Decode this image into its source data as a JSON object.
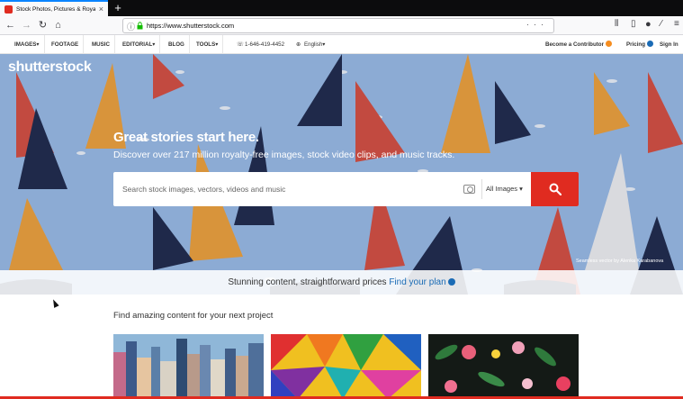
{
  "browser": {
    "tab_title": "Stock Photos, Pictures & Royalty",
    "new_tab_label": "+",
    "url": "https://www.shutterstock.com"
  },
  "sitenav": {
    "items": [
      "IMAGES▾",
      "FOOTAGE",
      "MUSIC",
      "EDITORIAL▾",
      "BLOG",
      "TOOLS▾"
    ],
    "phone": "1-646-419-4452",
    "language": "English▾",
    "contributor": "Become a Contributor",
    "pricing": "Pricing",
    "signin": "Sign In"
  },
  "hero": {
    "logo": "shutterstock",
    "headline": "Great stories start here.",
    "subhead": "Discover over 217 million royalty-free images, stock video clips, and music tracks.",
    "search_placeholder": "Search stock images, vectors, videos and music",
    "filter_label": "All Images",
    "credit": "Seamless vector by Alenka Karabanova"
  },
  "promo": {
    "text": "Stunning content, straightforward prices",
    "link": "Find your plan"
  },
  "content": {
    "section_title": "Find amazing content for your next project"
  },
  "colors": {
    "brand_red": "#e02b20",
    "link_blue": "#1a6bb5",
    "hero_bg": "#9bbde8",
    "contributor_orange": "#f58d1f"
  }
}
